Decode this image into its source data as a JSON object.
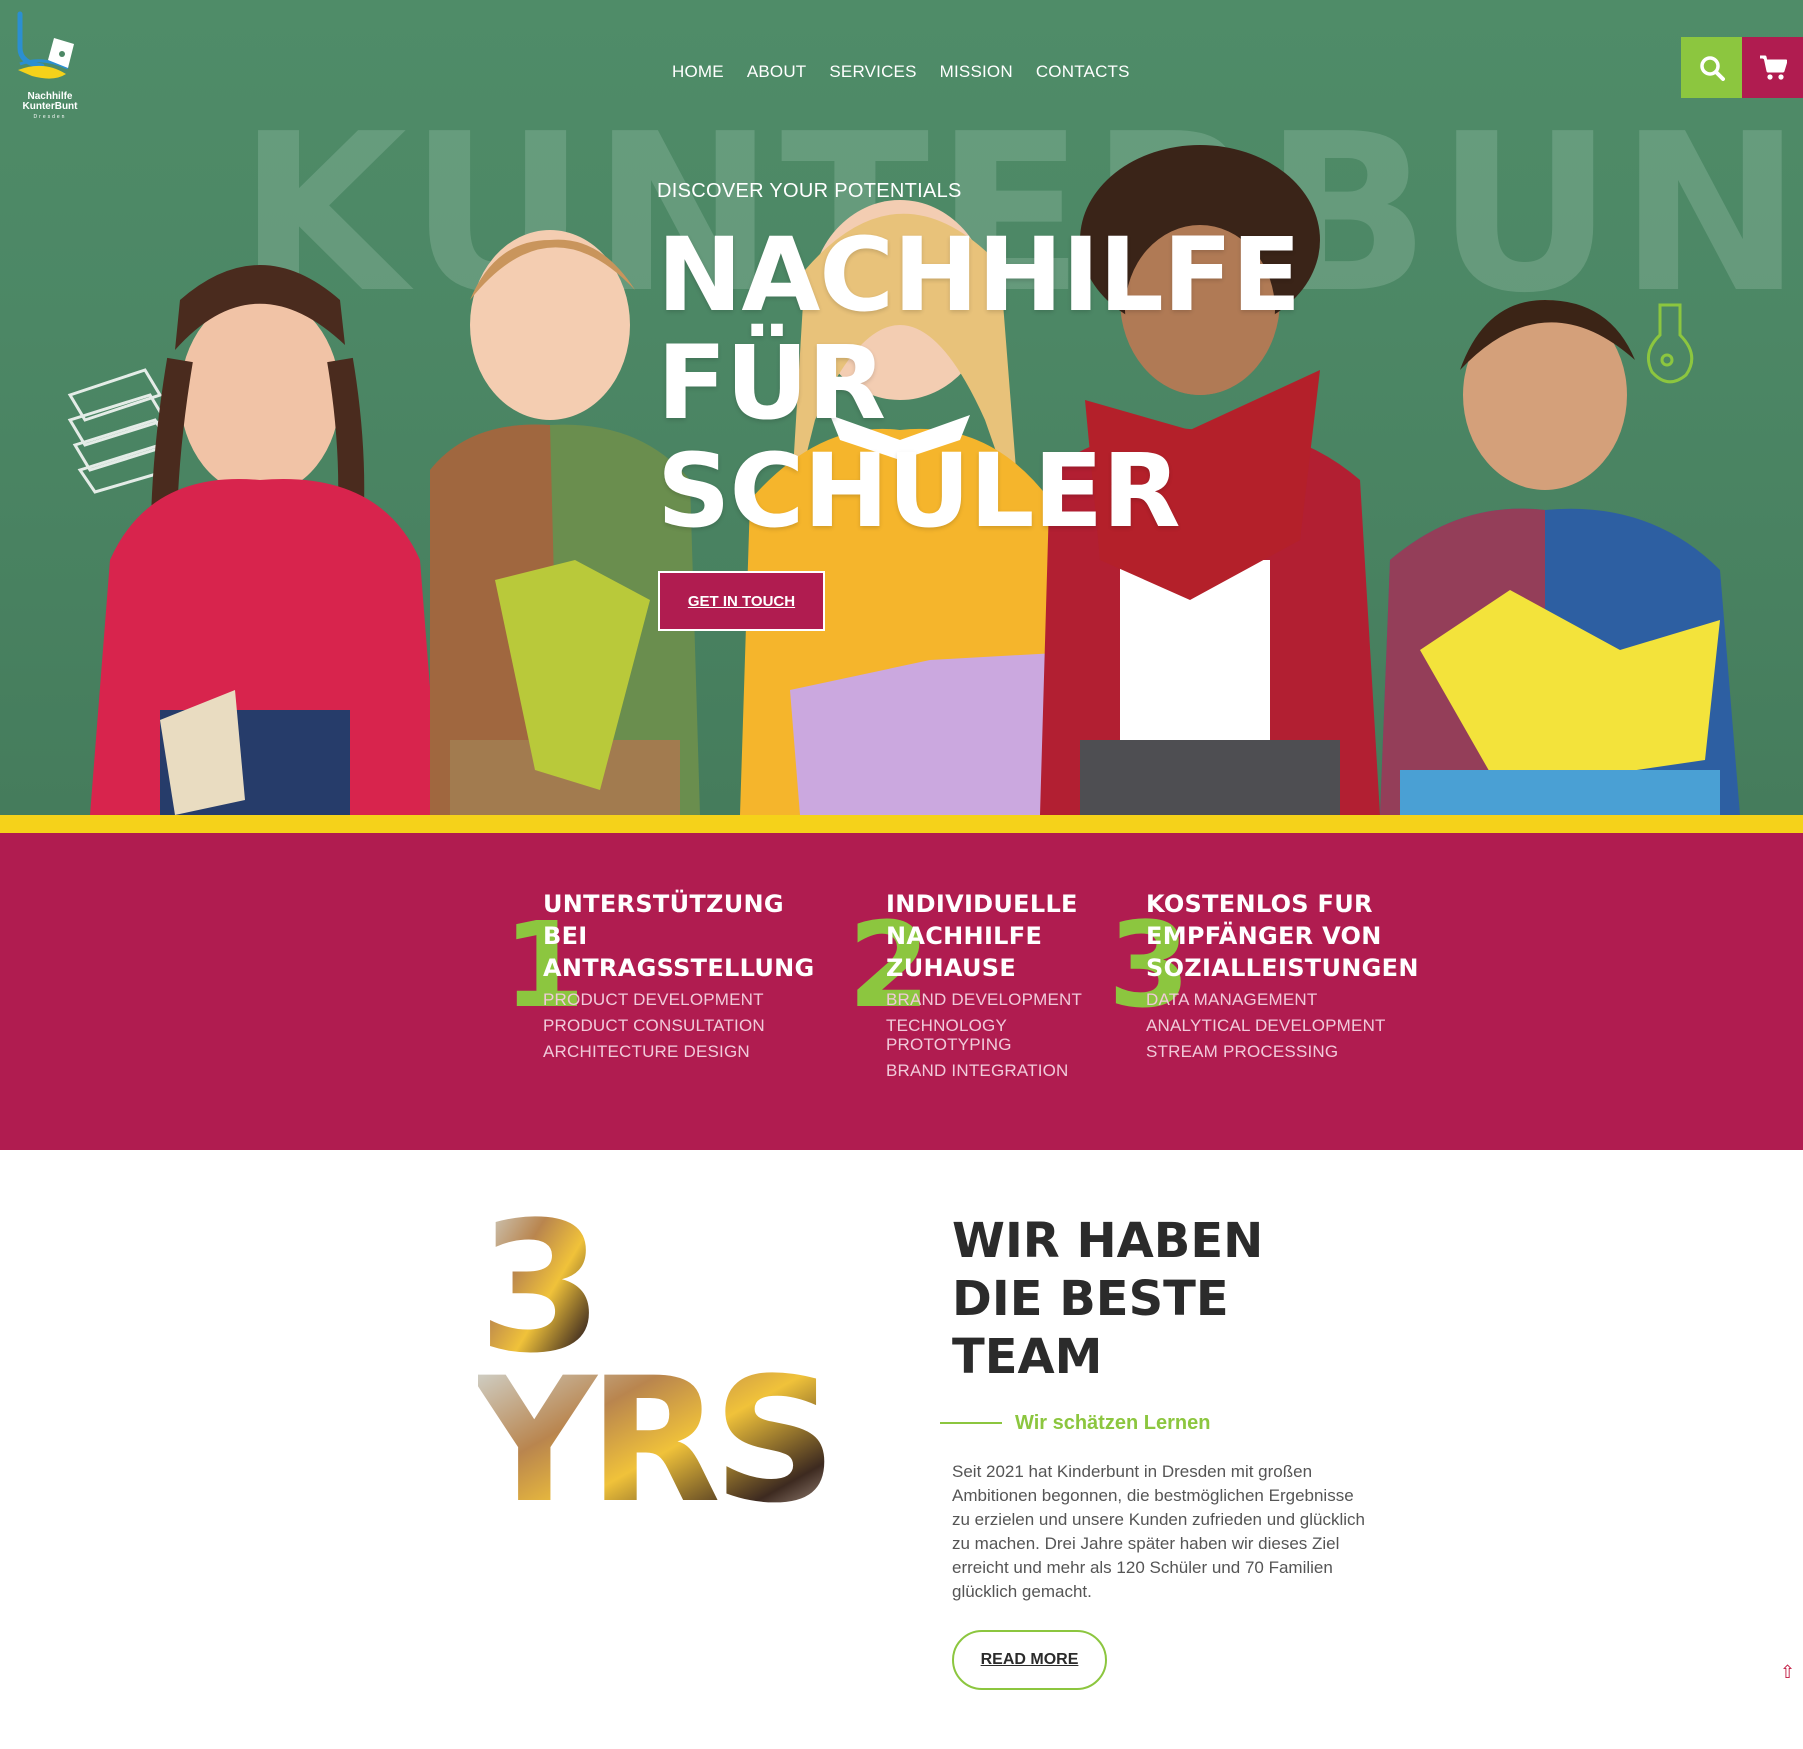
{
  "colors": {
    "hero_green": "#4c8765",
    "accent_green": "#8cc63f",
    "brand_crimson": "#b01c50",
    "highlight_yellow": "#f5d21a",
    "dark_text": "#2b2b2b"
  },
  "logo": {
    "line1": "Nachhilfe",
    "line2": "KunterBunt",
    "line3": "Dresden"
  },
  "nav": {
    "items": [
      "HOME",
      "ABOUT",
      "SERVICES",
      "MISSION",
      "CONTACTS"
    ]
  },
  "header_icons": {
    "search": "search-icon",
    "cart": "cart-icon"
  },
  "hero": {
    "background_word": "KUNTERBUNT",
    "subtitle": "DISCOVER YOUR POTENTIALS",
    "title_lines": [
      "NACHHILFE",
      "FÜR",
      "SCHULER"
    ],
    "cta_label": "GET IN TOUCH"
  },
  "features": [
    {
      "number": "1",
      "title_lines": [
        "UNTERSTÜTZUNG",
        "BEI",
        "ANTRAGSSTELLUNG"
      ],
      "items": [
        "PRODUCT DEVELOPMENT",
        "PRODUCT CONSULTATION",
        "ARCHITECTURE DESIGN"
      ]
    },
    {
      "number": "2",
      "title_lines": [
        "INDIVIDUELLE",
        "NACHHILFE",
        "ZUHAUSE"
      ],
      "items": [
        "BRAND DEVELOPMENT",
        "TECHNOLOGY PROTOTYPING",
        "BRAND INTEGRATION"
      ]
    },
    {
      "number": "3",
      "title_lines": [
        "KOSTENLOS FUR",
        "EMPFÄNGER VON",
        "SOZIALLEISTUNGEN"
      ],
      "items": [
        "DATA MANAGEMENT",
        "ANALYTICAL DEVELOPMENT",
        "STREAM PROCESSING"
      ]
    }
  ],
  "about": {
    "years_number": "3",
    "years_word": "YRS",
    "title_lines": [
      "WIR HABEN",
      "DIE BESTE",
      "TEAM"
    ],
    "tagline": "Wir schätzen Lernen",
    "text": "Seit 2021 hat Kinderbunt in Dresden mit großen Ambitionen begonnen, die bestmöglichen Ergebnisse zu erzielen und unsere Kunden zufrieden und glücklich zu machen. Drei Jahre später haben wir dieses Ziel erreicht und mehr als 120 Schüler und 70 Familien glücklich gemacht.",
    "read_more_label": "READ MORE"
  },
  "scroll_top_icon": "arrow-up-icon",
  "scroll_top_glyph": "⇧"
}
